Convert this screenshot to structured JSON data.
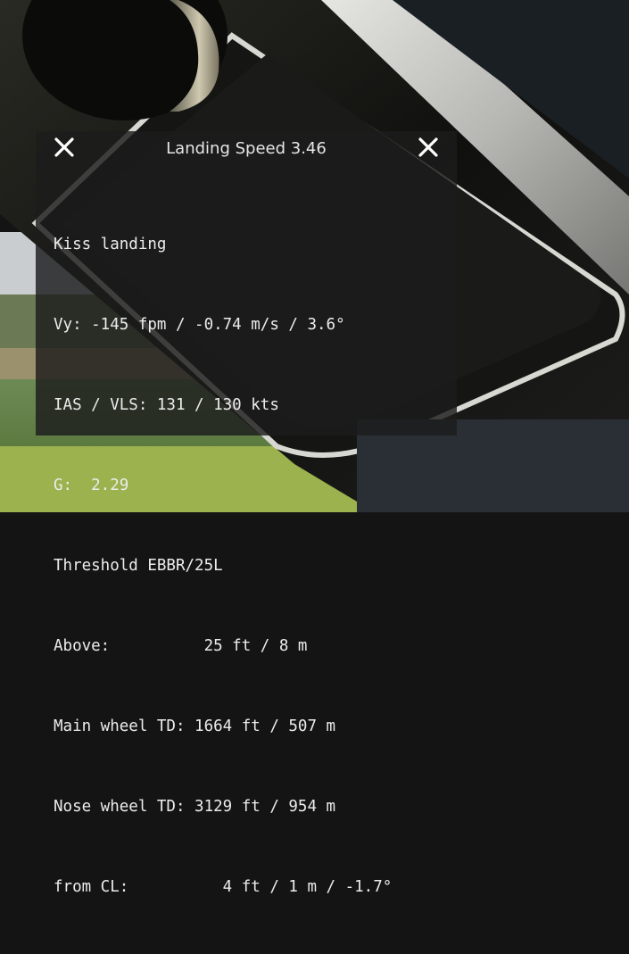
{
  "window": {
    "title": "Landing Speed 3.46",
    "close_left_icon": "close-icon",
    "close_right_icon": "close-icon"
  },
  "report": {
    "lines": [
      "Kiss landing",
      "Vy: -145 fpm / -0.74 m/s / 3.6°",
      "IAS / VLS: 131 / 130 kts",
      "G:  2.29",
      "Threshold EBBR/25L",
      "Above:          25 ft / 8 m",
      "Main wheel TD: 1664 ft / 507 m",
      "Nose wheel TD: 3129 ft / 954 m",
      "from CL:          4 ft / 1 m / -1.7°"
    ]
  },
  "colors": {
    "panel_bg": "#1c1c1c",
    "text": "#ececec",
    "grass": "#4f7a2e",
    "sky": "#c9cdd0"
  }
}
